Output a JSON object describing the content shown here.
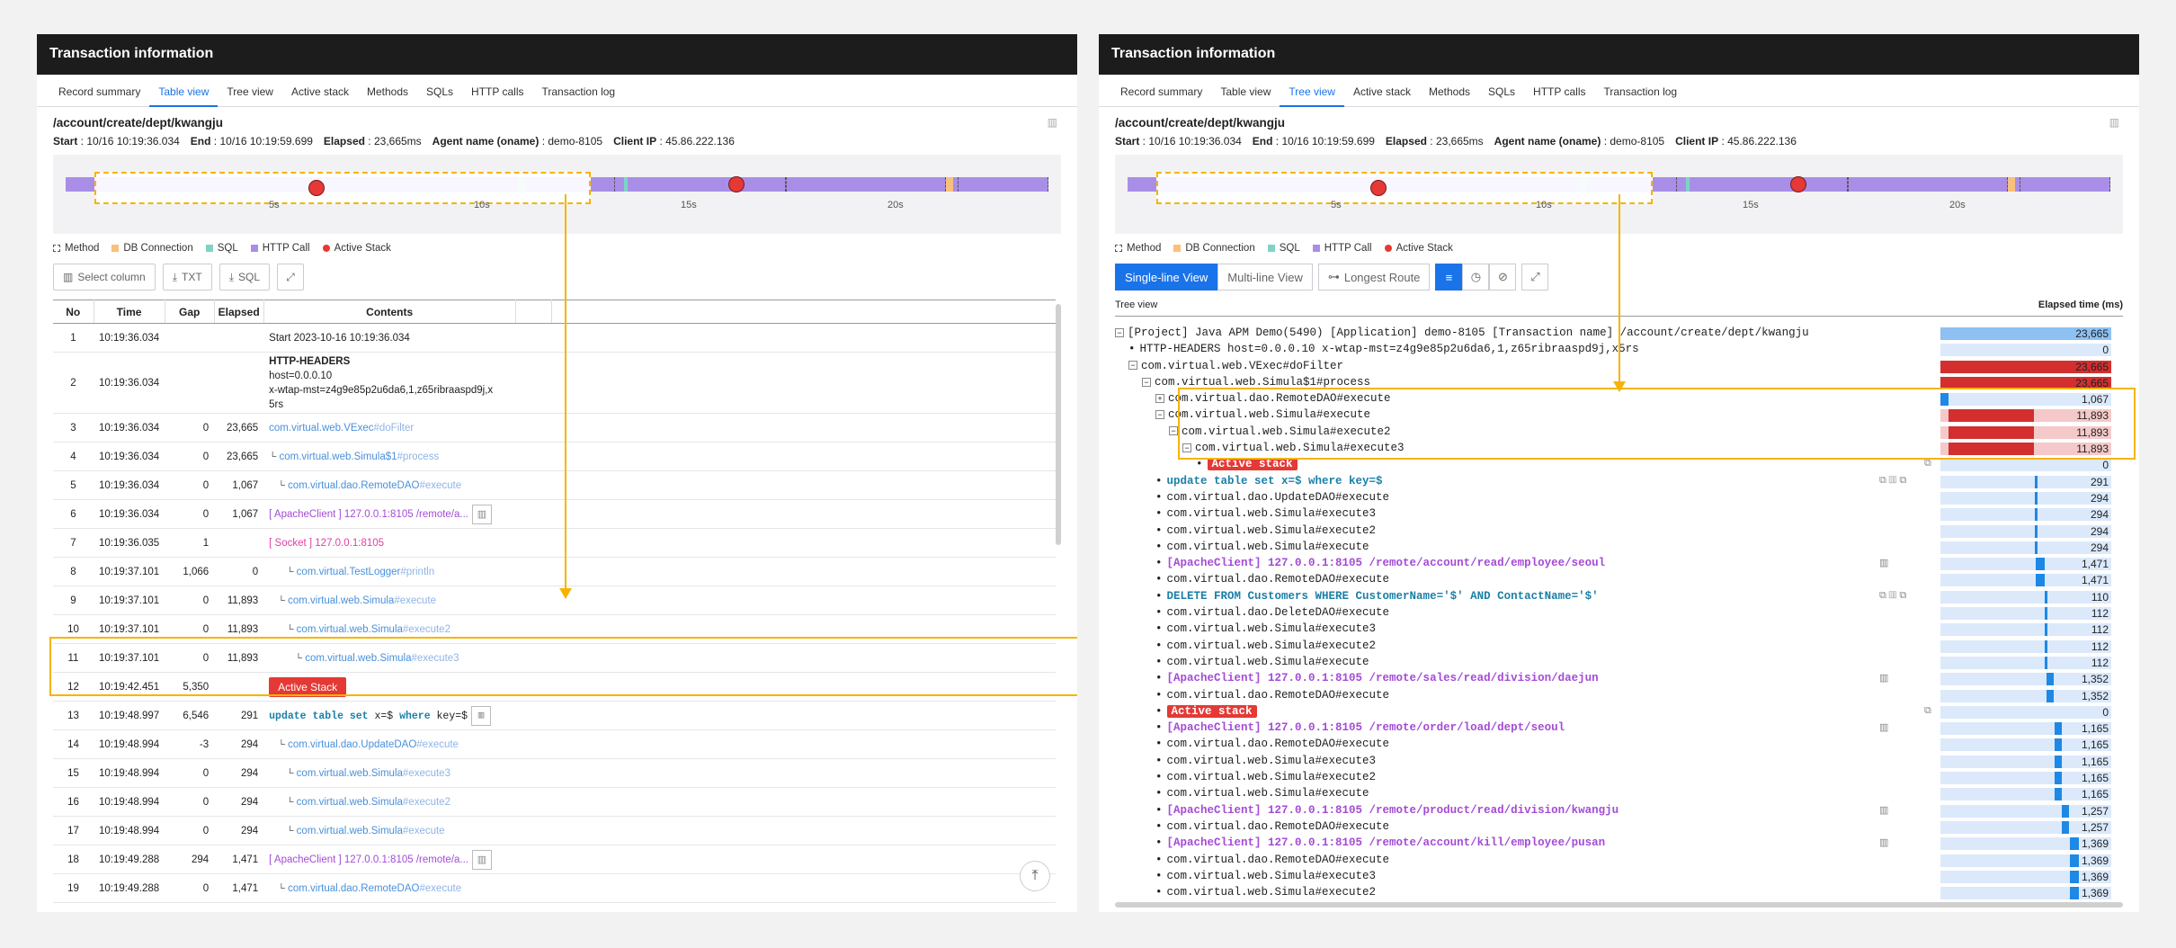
{
  "left": {
    "title": "Transaction information",
    "tabs": [
      "Record summary",
      "Table view",
      "Tree view",
      "Active stack",
      "Methods",
      "SQLs",
      "HTTP calls",
      "Transaction log"
    ],
    "active_tab": "Table view",
    "path": "/account/create/dept/kwangju",
    "meta": {
      "start_label": "Start",
      "start": "10/16 10:19:36.034",
      "end_label": "End",
      "end": "10/16 10:19:59.699",
      "elapsed_label": "Elapsed",
      "elapsed": "23,665ms",
      "agent_label": "Agent name (oname)",
      "agent": "demo-8105",
      "client_label": "Client IP",
      "client": "45.86.222.136"
    },
    "ticks": [
      "5s",
      "10s",
      "15s",
      "20s"
    ],
    "legend": [
      "Method",
      "DB Connection",
      "SQL",
      "HTTP Call",
      "Active Stack"
    ],
    "toolbar": {
      "select_column": "Select column",
      "txt": "TXT",
      "sql": "SQL"
    },
    "columns": [
      "No",
      "Time",
      "Gap",
      "Elapsed",
      "Contents"
    ],
    "rows": [
      {
        "no": "1",
        "time": "10:19:36.034",
        "gap": "",
        "el": "",
        "type": "text",
        "c": "Start  2023-10-16 10:19:36.034"
      },
      {
        "no": "2",
        "time": "10:19:36.034",
        "gap": "",
        "el": "",
        "type": "headers",
        "c": "HTTP-HEADERS",
        "c2": "host=0.0.0.10",
        "c3": "x-wtap-mst=z4g9e85p2u6da6,1,z65ribraaspd9j,x",
        "c4": "5rs"
      },
      {
        "no": "3",
        "time": "10:19:36.034",
        "gap": "0",
        "el": "23,665",
        "type": "method",
        "pre": "",
        "c": "com.virtual.web.VExec",
        "m": "#doFilter"
      },
      {
        "no": "4",
        "time": "10:19:36.034",
        "gap": "0",
        "el": "23,665",
        "type": "method",
        "pre": "└ ",
        "c": "com.virtual.web.Simula$1",
        "m": "#process"
      },
      {
        "no": "5",
        "time": "10:19:36.034",
        "gap": "0",
        "el": "1,067",
        "type": "method",
        "pre": "   └ ",
        "c": "com.virtual.dao.RemoteDAO",
        "m": "#execute"
      },
      {
        "no": "6",
        "time": "10:19:36.034",
        "gap": "0",
        "el": "1,067",
        "type": "http",
        "c": "[ ApacheClient ] 127.0.0.1:8105 /remote/a..."
      },
      {
        "no": "7",
        "time": "10:19:36.035",
        "gap": "1",
        "el": "",
        "type": "socket",
        "c": "[ Socket ]  127.0.0.1:8105"
      },
      {
        "no": "8",
        "time": "10:19:37.101",
        "gap": "1,066",
        "el": "0",
        "type": "method",
        "pre": "      └ ",
        "c": "com.virtual.TestLogger",
        "m": "#println"
      },
      {
        "no": "9",
        "time": "10:19:37.101",
        "gap": "0",
        "el": "11,893",
        "type": "method",
        "pre": "   └ ",
        "c": "com.virtual.web.Simula",
        "m": "#execute"
      },
      {
        "no": "10",
        "time": "10:19:37.101",
        "gap": "0",
        "el": "11,893",
        "type": "method",
        "pre": "      └ ",
        "c": "com.virtual.web.Simula",
        "m": "#execute2"
      },
      {
        "no": "11",
        "time": "10:19:37.101",
        "gap": "0",
        "el": "11,893",
        "type": "method",
        "pre": "         └ ",
        "c": "com.virtual.web.Simula",
        "m": "#execute3"
      },
      {
        "no": "12",
        "time": "10:19:42.451",
        "gap": "5,350",
        "el": "",
        "type": "active",
        "c": "Active Stack"
      },
      {
        "no": "13",
        "time": "10:19:48.997",
        "gap": "6,546",
        "el": "291",
        "type": "sql",
        "kw1": "update table set",
        "mid": " x=$ ",
        "kw2": "where",
        "end": " key=$"
      },
      {
        "no": "14",
        "time": "10:19:48.994",
        "gap": "-3",
        "el": "294",
        "type": "method",
        "pre": "   └ ",
        "c": "com.virtual.dao.UpdateDAO",
        "m": "#execute"
      },
      {
        "no": "15",
        "time": "10:19:48.994",
        "gap": "0",
        "el": "294",
        "type": "method",
        "pre": "      └ ",
        "c": "com.virtual.web.Simula",
        "m": "#execute3"
      },
      {
        "no": "16",
        "time": "10:19:48.994",
        "gap": "0",
        "el": "294",
        "type": "method",
        "pre": "      └ ",
        "c": "com.virtual.web.Simula",
        "m": "#execute2"
      },
      {
        "no": "17",
        "time": "10:19:48.994",
        "gap": "0",
        "el": "294",
        "type": "method",
        "pre": "      └ ",
        "c": "com.virtual.web.Simula",
        "m": "#execute"
      },
      {
        "no": "18",
        "time": "10:19:49.288",
        "gap": "294",
        "el": "1,471",
        "type": "http",
        "c": "[ ApacheClient ] 127.0.0.1:8105 /remote/a..."
      },
      {
        "no": "19",
        "time": "10:19:49.288",
        "gap": "0",
        "el": "1,471",
        "type": "method",
        "pre": "   └ ",
        "c": "com.virtual.dao.RemoteDAO",
        "m": "#execute"
      }
    ],
    "partial_row": "DELETE FROM Customers"
  },
  "right": {
    "title": "Transaction information",
    "tabs": [
      "Record summary",
      "Table view",
      "Tree view",
      "Active stack",
      "Methods",
      "SQLs",
      "HTTP calls",
      "Transaction log"
    ],
    "active_tab": "Tree view",
    "path": "/account/create/dept/kwangju",
    "meta": {
      "start_label": "Start",
      "start": "10/16 10:19:36.034",
      "end_label": "End",
      "end": "10/16 10:19:59.699",
      "elapsed_label": "Elapsed",
      "elapsed": "23,665ms",
      "agent_label": "Agent name (oname)",
      "agent": "demo-8105",
      "client_label": "Client IP",
      "client": "45.86.222.136"
    },
    "ticks": [
      "5s",
      "10s",
      "15s",
      "20s"
    ],
    "legend": [
      "Method",
      "DB Connection",
      "SQL",
      "HTTP Call",
      "Active Stack"
    ],
    "view_buttons": [
      "Single-line View",
      "Multi-line View",
      "Longest Route"
    ],
    "tree_label": "Tree view",
    "elapsed_header": "Elapsed time (ms)",
    "tree": [
      {
        "ind": 0,
        "box": "-",
        "t": "[Project] Java APM Demo(5490) [Application] demo-8105 [Transaction name] /account/create/dept/kwangju",
        "v": "23,665",
        "f": 1,
        "c": "#8ec0f2",
        "s": 0
      },
      {
        "ind": 1,
        "bul": true,
        "t": "HTTP-HEADERS host=0.0.0.10 x-wtap-mst=z4g9e85p2u6da6,1,z65ribraaspd9j,x5rs",
        "v": "0",
        "f": 0,
        "c": "#8ec0f2",
        "s": 0
      },
      {
        "ind": 1,
        "box": "-",
        "t": "com.virtual.web.VExec#doFilter",
        "v": "23,665",
        "f": 1,
        "c": "#d32f2f",
        "s": 0
      },
      {
        "ind": 2,
        "box": "-",
        "t": "com.virtual.web.Simula$1#process",
        "v": "23,665",
        "f": 1,
        "c": "#d32f2f",
        "s": 0
      },
      {
        "ind": 3,
        "box": "+",
        "t": "com.virtual.dao.RemoteDAO#execute",
        "v": "1,067",
        "f": 0.045,
        "c": "#1e88e5",
        "s": 0
      },
      {
        "ind": 3,
        "box": "-",
        "t": "com.virtual.web.Simula#execute",
        "v": "11,893",
        "f": 0.5,
        "c": "#d32f2f",
        "s": 0.045,
        "bg": "#f5c9c9"
      },
      {
        "ind": 4,
        "box": "-",
        "t": "com.virtual.web.Simula#execute2",
        "v": "11,893",
        "f": 0.5,
        "c": "#d32f2f",
        "s": 0.045,
        "bg": "#f5c9c9"
      },
      {
        "ind": 5,
        "box": "-",
        "t": "com.virtual.web.Simula#execute3",
        "v": "11,893",
        "f": 0.5,
        "c": "#d32f2f",
        "s": 0.045,
        "bg": "#f5c9c9"
      },
      {
        "ind": 6,
        "bul": true,
        "tag": "Active stack",
        "v": "0",
        "f": 0,
        "c": "#1e88e5",
        "s": 0,
        "icons": "⧉"
      },
      {
        "ind": 3,
        "bul": true,
        "sql": "update table set x=$ where key=$",
        "v": "291",
        "f": 0.012,
        "c": "#1e88e5",
        "s": 0.55,
        "icons": "⧉ ▥ ⧉"
      },
      {
        "ind": 3,
        "bul": true,
        "t": "com.virtual.dao.UpdateDAO#execute",
        "v": "294",
        "f": 0.012,
        "c": "#1e88e5",
        "s": 0.55
      },
      {
        "ind": 3,
        "bul": true,
        "t": "com.virtual.web.Simula#execute3",
        "v": "294",
        "f": 0.012,
        "c": "#1e88e5",
        "s": 0.55
      },
      {
        "ind": 3,
        "bul": true,
        "t": "com.virtual.web.Simula#execute2",
        "v": "294",
        "f": 0.012,
        "c": "#1e88e5",
        "s": 0.55
      },
      {
        "ind": 3,
        "bul": true,
        "t": "com.virtual.web.Simula#execute",
        "v": "294",
        "f": 0.012,
        "c": "#1e88e5",
        "s": 0.55
      },
      {
        "ind": 3,
        "bul": true,
        "http": "[ApacheClient] 127.0.0.1:8105 /remote/account/read/employee/seoul",
        "v": "1,471",
        "f": 0.05,
        "c": "#1e88e5",
        "s": 0.56,
        "icons": "▥"
      },
      {
        "ind": 3,
        "bul": true,
        "t": "com.virtual.dao.RemoteDAO#execute",
        "v": "1,471",
        "f": 0.05,
        "c": "#1e88e5",
        "s": 0.56
      },
      {
        "ind": 3,
        "bul": true,
        "sql": "DELETE FROM Customers WHERE CustomerName='$' AND ContactName='$'",
        "v": "110",
        "f": 0.006,
        "c": "#1e88e5",
        "s": 0.61,
        "icons": "⧉ ▥ ⧉"
      },
      {
        "ind": 3,
        "bul": true,
        "t": "com.virtual.dao.DeleteDAO#execute",
        "v": "112",
        "f": 0.006,
        "c": "#1e88e5",
        "s": 0.61
      },
      {
        "ind": 3,
        "bul": true,
        "t": "com.virtual.web.Simula#execute3",
        "v": "112",
        "f": 0.006,
        "c": "#1e88e5",
        "s": 0.61
      },
      {
        "ind": 3,
        "bul": true,
        "t": "com.virtual.web.Simula#execute2",
        "v": "112",
        "f": 0.006,
        "c": "#1e88e5",
        "s": 0.61
      },
      {
        "ind": 3,
        "bul": true,
        "t": "com.virtual.web.Simula#execute",
        "v": "112",
        "f": 0.006,
        "c": "#1e88e5",
        "s": 0.61
      },
      {
        "ind": 3,
        "bul": true,
        "http": "[ApacheClient] 127.0.0.1:8105 /remote/sales/read/division/daejun",
        "v": "1,352",
        "f": 0.045,
        "c": "#1e88e5",
        "s": 0.62,
        "icons": "▥"
      },
      {
        "ind": 3,
        "bul": true,
        "t": "com.virtual.dao.RemoteDAO#execute",
        "v": "1,352",
        "f": 0.045,
        "c": "#1e88e5",
        "s": 0.62
      },
      {
        "ind": 3,
        "bul": true,
        "tag": "Active stack",
        "v": "0",
        "f": 0,
        "c": "#1e88e5",
        "s": 0,
        "icons": "⧉"
      },
      {
        "ind": 3,
        "bul": true,
        "http": "[ApacheClient] 127.0.0.1:8105 /remote/order/load/dept/seoul",
        "v": "1,165",
        "f": 0.04,
        "c": "#1e88e5",
        "s": 0.67,
        "icons": "▥"
      },
      {
        "ind": 3,
        "bul": true,
        "t": "com.virtual.dao.RemoteDAO#execute",
        "v": "1,165",
        "f": 0.04,
        "c": "#1e88e5",
        "s": 0.67
      },
      {
        "ind": 3,
        "bul": true,
        "t": "com.virtual.web.Simula#execute3",
        "v": "1,165",
        "f": 0.04,
        "c": "#1e88e5",
        "s": 0.67
      },
      {
        "ind": 3,
        "bul": true,
        "t": "com.virtual.web.Simula#execute2",
        "v": "1,165",
        "f": 0.04,
        "c": "#1e88e5",
        "s": 0.67
      },
      {
        "ind": 3,
        "bul": true,
        "t": "com.virtual.web.Simula#execute",
        "v": "1,165",
        "f": 0.04,
        "c": "#1e88e5",
        "s": 0.67
      },
      {
        "ind": 3,
        "bul": true,
        "http": "[ApacheClient] 127.0.0.1:8105 /remote/product/read/division/kwangju",
        "v": "1,257",
        "f": 0.045,
        "c": "#1e88e5",
        "s": 0.71,
        "icons": "▥"
      },
      {
        "ind": 3,
        "bul": true,
        "t": "com.virtual.dao.RemoteDAO#execute",
        "v": "1,257",
        "f": 0.045,
        "c": "#1e88e5",
        "s": 0.71
      },
      {
        "ind": 3,
        "bul": true,
        "http": "[ApacheClient] 127.0.0.1:8105 /remote/account/kill/employee/pusan",
        "v": "1,369",
        "f": 0.05,
        "c": "#1e88e5",
        "s": 0.76,
        "icons": "▥"
      },
      {
        "ind": 3,
        "bul": true,
        "t": "com.virtual.dao.RemoteDAO#execute",
        "v": "1,369",
        "f": 0.05,
        "c": "#1e88e5",
        "s": 0.76
      },
      {
        "ind": 3,
        "bul": true,
        "t": "com.virtual.web.Simula#execute3",
        "v": "1,369",
        "f": 0.05,
        "c": "#1e88e5",
        "s": 0.76
      },
      {
        "ind": 3,
        "bul": true,
        "t": "com.virtual.web.Simula#execute2",
        "v": "1,369",
        "f": 0.05,
        "c": "#1e88e5",
        "s": 0.76
      }
    ]
  }
}
